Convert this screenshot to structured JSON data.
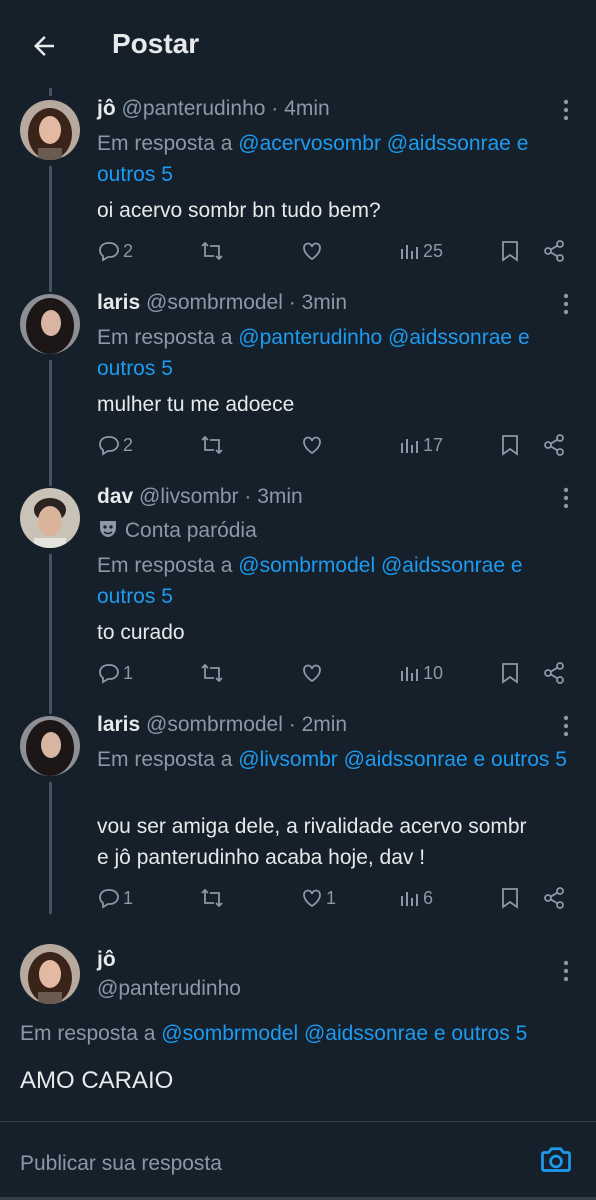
{
  "header": {
    "title": "Postar"
  },
  "tweets": [
    {
      "name": "jô",
      "handle": "@panterudinho",
      "time": "4min",
      "reply_prefix": "Em resposta a",
      "mentions": [
        "@acervosombr",
        "@aidssonrae"
      ],
      "reply_suffix": "e outros 5",
      "text": "oi acervo sombr bn tudo bem?",
      "replies": "2",
      "reposts": "",
      "likes": "",
      "views": "25"
    },
    {
      "name": "laris",
      "handle": "@sombrmodel",
      "time": "3min",
      "reply_prefix": "Em resposta a",
      "mentions": [
        "@panterudinho",
        "@aidssonrae"
      ],
      "reply_suffix": "e outros 5",
      "text": "mulher tu me adoece",
      "replies": "2",
      "reposts": "",
      "likes": "",
      "views": "17"
    },
    {
      "name": "dav",
      "handle": "@livsombr",
      "time": "3min",
      "parody_label": "Conta paródia",
      "reply_prefix": "Em resposta a",
      "mentions": [
        "@sombrmodel",
        "@aidssonrae"
      ],
      "reply_suffix": "e outros 5",
      "text": "to curado",
      "replies": "1",
      "reposts": "",
      "likes": "",
      "views": "10"
    },
    {
      "name": "laris",
      "handle": "@sombrmodel",
      "time": "2min",
      "reply_prefix": "Em resposta a",
      "mentions": [
        "@livsombr",
        "@aidssonrae"
      ],
      "reply_suffix": "e outros 5",
      "text_line1": "vou ser amiga dele, a rivalidade acervo sombr",
      "text_line2": "e jô panterudinho acaba hoje, dav !",
      "replies": "1",
      "reposts": "",
      "likes": "1",
      "views": "6"
    }
  ],
  "main_post": {
    "name": "jô",
    "handle": "@panterudinho",
    "reply_prefix": "Em resposta a",
    "mentions": [
      "@sombrmodel",
      "@aidssonrae"
    ],
    "reply_suffix": "e outros 5",
    "text": "AMO CARAIO"
  },
  "composer": {
    "placeholder": "Publicar sua resposta"
  },
  "icons": {
    "back": "arrow-left-icon",
    "more": "more-vertical-icon",
    "reply": "reply-icon",
    "repost": "repost-icon",
    "like": "heart-icon",
    "views": "views-icon",
    "bookmark": "bookmark-icon",
    "share": "share-icon",
    "camera": "camera-icon",
    "parody": "mask-icon"
  },
  "colors": {
    "background": "#15202b",
    "text": "#e7e9ea",
    "muted": "#8b98a5",
    "accent": "#1d9bf0",
    "thread_line": "#425364"
  }
}
